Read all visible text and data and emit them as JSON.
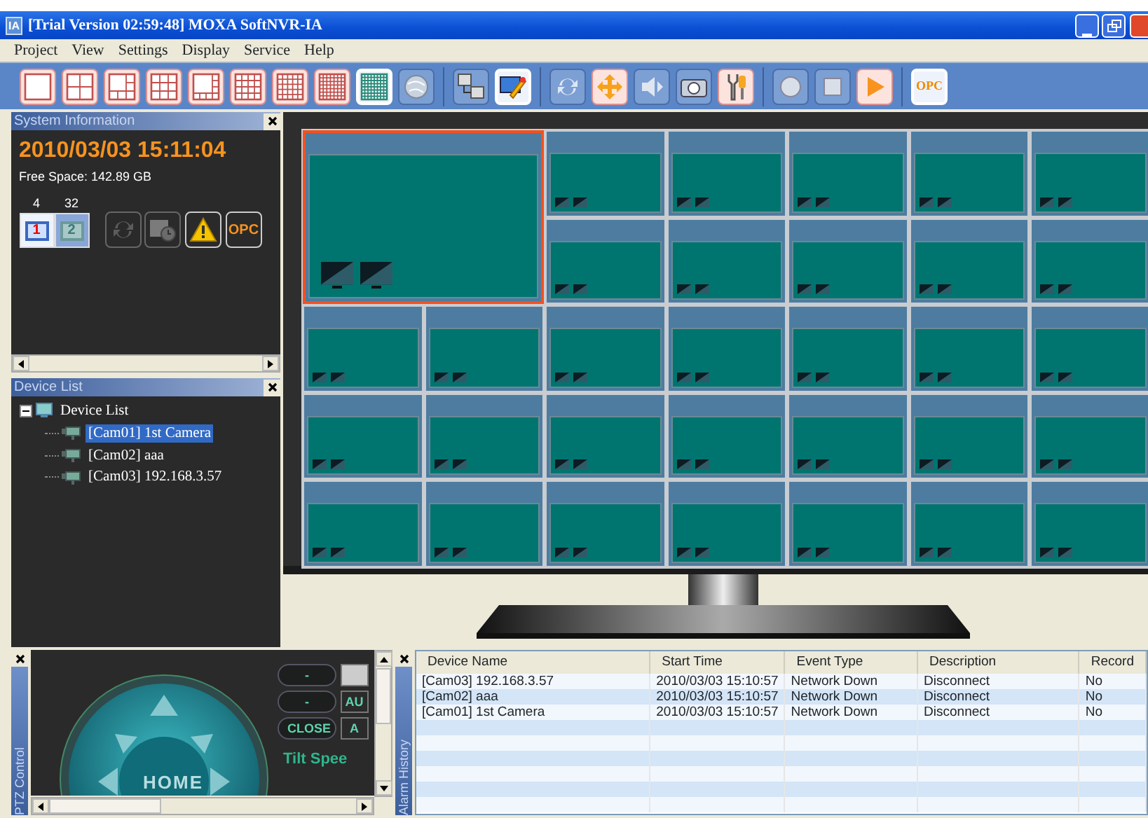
{
  "window": {
    "title": "[Trial Version 02:59:48] MOXA SoftNVR-IA",
    "app_icon": "IA"
  },
  "menu": [
    "Project",
    "View",
    "Settings",
    "Display",
    "Service",
    "Help"
  ],
  "toolbar": [
    {
      "kind": "layout1",
      "enabled": true,
      "selected": false
    },
    {
      "kind": "layout4",
      "enabled": true,
      "selected": false
    },
    {
      "kind": "layout6",
      "enabled": true,
      "selected": false
    },
    {
      "kind": "layout9",
      "enabled": true,
      "selected": false
    },
    {
      "kind": "layout10",
      "enabled": true,
      "selected": false
    },
    {
      "kind": "layout13",
      "enabled": true,
      "selected": false
    },
    {
      "kind": "layout16",
      "enabled": true,
      "selected": false
    },
    {
      "kind": "layout25",
      "enabled": true,
      "selected": false
    },
    {
      "kind": "layout32",
      "enabled": true,
      "selected": true
    },
    {
      "kind": "globe",
      "enabled": false,
      "selected": false
    },
    {
      "kind": "separator"
    },
    {
      "kind": "network",
      "enabled": false,
      "selected": false
    },
    {
      "kind": "edit",
      "enabled": true,
      "selected": true
    },
    {
      "kind": "separator"
    },
    {
      "kind": "refresh",
      "enabled": false,
      "selected": false
    },
    {
      "kind": "move",
      "enabled": true,
      "selected": false
    },
    {
      "kind": "audio",
      "enabled": false,
      "selected": false
    },
    {
      "kind": "snapshot",
      "enabled": false,
      "selected": false
    },
    {
      "kind": "tools",
      "enabled": true,
      "selected": false
    },
    {
      "kind": "separator"
    },
    {
      "kind": "record",
      "enabled": false,
      "selected": false
    },
    {
      "kind": "stop",
      "enabled": false,
      "selected": false
    },
    {
      "kind": "play",
      "enabled": true,
      "selected": false
    },
    {
      "kind": "separator"
    },
    {
      "kind": "opc",
      "label": "OPC",
      "enabled": true,
      "selected": true
    }
  ],
  "system_info": {
    "title": "System Information",
    "datetime": "2010/03/03 15:11:04",
    "free_space": "Free Space:  142.89 GB",
    "monitors": [
      {
        "count": "4",
        "label": "1",
        "selected": true
      },
      {
        "count": "32",
        "label": "2",
        "selected": false
      }
    ],
    "actions": [
      {
        "kind": "refresh",
        "enabled": false
      },
      {
        "kind": "schedule",
        "enabled": false
      },
      {
        "kind": "warning",
        "enabled": true
      },
      {
        "kind": "opc",
        "label": "OPC",
        "enabled": true
      }
    ]
  },
  "device_list": {
    "title": "Device List",
    "tree": [
      {
        "label": "Device List",
        "expanded": true,
        "selected": false,
        "children": [
          {
            "label": "[Cam01] 1st Camera",
            "selected": true
          },
          {
            "label": "[Cam02] aaa",
            "selected": false
          },
          {
            "label": "[Cam03] 192.168.3.57",
            "selected": false
          }
        ]
      }
    ]
  },
  "video_grid": [
    {
      "kind": "large",
      "selected": true
    },
    {
      "kind": "small",
      "selected": false
    },
    {
      "kind": "small",
      "selected": false
    },
    {
      "kind": "small",
      "selected": false
    },
    {
      "kind": "small",
      "selected": false
    },
    {
      "kind": "small",
      "selected": false
    },
    {
      "kind": "small",
      "selected": false
    },
    {
      "kind": "small",
      "selected": false
    },
    {
      "kind": "small",
      "selected": false
    },
    {
      "kind": "small",
      "selected": false
    },
    {
      "kind": "small",
      "selected": false
    },
    {
      "kind": "small",
      "selected": false
    },
    {
      "kind": "small",
      "selected": false
    },
    {
      "kind": "small",
      "selected": false
    },
    {
      "kind": "small",
      "selected": false
    },
    {
      "kind": "small",
      "selected": false
    },
    {
      "kind": "small",
      "selected": false
    },
    {
      "kind": "small",
      "selected": false
    },
    {
      "kind": "small",
      "selected": false
    },
    {
      "kind": "small",
      "selected": false
    },
    {
      "kind": "small",
      "selected": false
    },
    {
      "kind": "small",
      "selected": false
    },
    {
      "kind": "small",
      "selected": false
    },
    {
      "kind": "small",
      "selected": false
    },
    {
      "kind": "small",
      "selected": false
    },
    {
      "kind": "small",
      "selected": false
    },
    {
      "kind": "small",
      "selected": false
    },
    {
      "kind": "small",
      "selected": false
    },
    {
      "kind": "small",
      "selected": false
    },
    {
      "kind": "small",
      "selected": false
    },
    {
      "kind": "small",
      "selected": false
    },
    {
      "kind": "small",
      "selected": false
    }
  ],
  "ptz": {
    "title": "PTZ Control",
    "home": "HOME",
    "left_buttons": [
      "-",
      "-",
      "CLOSE"
    ],
    "right_buttons": [
      {
        "kind": "blank"
      },
      {
        "kind": "text",
        "label": "AU"
      },
      {
        "kind": "text",
        "label": "A"
      }
    ],
    "tilt_speed": "Tilt Spee"
  },
  "alarm_history": {
    "title": "Alarm History",
    "columns": [
      "Device Name",
      "Start Time",
      "Event Type",
      "Description",
      "Record"
    ],
    "rows": [
      [
        "[Cam03] 192.168.3.57",
        "2010/03/03 15:10:57",
        "Network Down",
        "Disconnect",
        "No"
      ],
      [
        "[Cam02] aaa",
        "2010/03/03 15:10:57",
        "Network Down",
        "Disconnect",
        "No"
      ],
      [
        "[Cam01] 1st Camera",
        "2010/03/03 15:10:57",
        "Network Down",
        "Disconnect",
        "No"
      ]
    ]
  }
}
